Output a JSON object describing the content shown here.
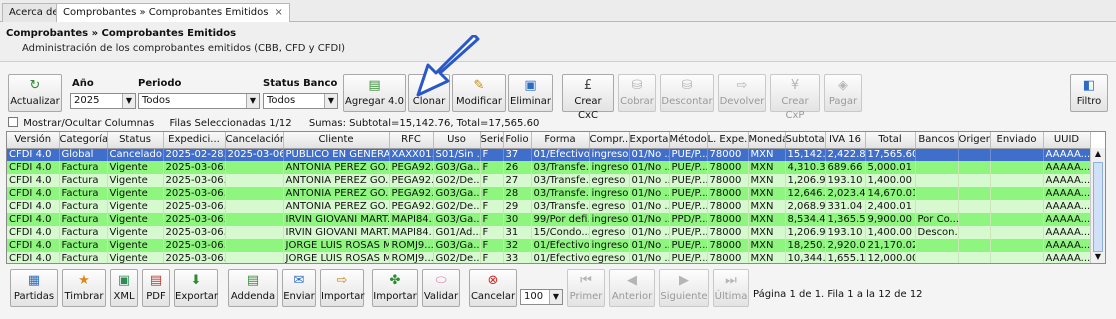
{
  "tabs": [
    {
      "label": "Acerca de"
    },
    {
      "label": "Comprobantes » Comprobantes Emitidos",
      "close": "×"
    }
  ],
  "header": {
    "title": "Comprobantes » Comprobantes Emitidos",
    "subtitle": "Administración de los comprobantes emitidos (CBB, CFD y CFDI)"
  },
  "filters": {
    "year_label": "Año",
    "year_value": "2025",
    "period_label": "Periodo",
    "period_value": "Todos",
    "bank_label": "Status Banco",
    "bank_value": "Todos"
  },
  "toolbar": {
    "refresh": "Actualizar",
    "add": "Agregar 4.0",
    "clone": "Clonar",
    "modify": "Modificar",
    "delete": "Eliminar",
    "create_cxc": "Crear CxC",
    "charge": "Cobrar",
    "discount": "Descontar",
    "return": "Devolver",
    "create_cxp": "Crear CxP",
    "pay": "Pagar",
    "filter": "Filtro"
  },
  "info": {
    "show_hide": "Mostrar/Ocultar Columnas",
    "selected": "Filas Seleccionadas 1/12",
    "sums": "Sumas:  Subtotal=15,142.76, Total=17,565.60"
  },
  "columns": [
    "Versión",
    "Categoría",
    "Status",
    "Expedici...",
    "Cancelación",
    "Cliente",
    "RFC",
    "Uso",
    "Serie",
    "Folio",
    "Forma",
    "Compr...",
    "Exporta...",
    "Método",
    "L. Expe...",
    "Moneda",
    "Subtotal",
    "IVA 16",
    "Total",
    "Bancos",
    "Origen",
    "Enviado",
    "UUID"
  ],
  "rows": [
    [
      "CFDI 4.0",
      "Global",
      "Cancelado",
      "2025-02-28...",
      "2025-03-06...",
      "PUBLICO EN GENERAL",
      "XAXX01...",
      "S01/Sin ...",
      "F",
      "37",
      "01/Efectivo",
      "ingreso",
      "01/No ...",
      "PUE/P...",
      "78000",
      "MXN",
      "15,142...",
      "2,422.84",
      "17,565.60",
      "",
      "",
      "",
      "AAAAA..."
    ],
    [
      "CFDI 4.0",
      "Factura",
      "Vigente",
      "2025-03-06...",
      "",
      "ANTONIA PEREZ GO...",
      "PEGA92...",
      "G03/Ga...",
      "F",
      "26",
      "03/Transfe...",
      "ingreso",
      "01/No ...",
      "PUE/P...",
      "78000",
      "MXN",
      "4,310.35",
      "689.66",
      "5,000.01",
      "",
      "",
      "",
      "AAAAA..."
    ],
    [
      "CFDI 4.0",
      "Factura",
      "Vigente",
      "2025-03-06...",
      "",
      "ANTONIA PEREZ GO...",
      "PEGA92...",
      "G02/De...",
      "F",
      "27",
      "03/Transfe...",
      "egreso",
      "01/No ...",
      "PUE/P...",
      "78000",
      "MXN",
      "1,206.90",
      "193.10",
      "1,400.00",
      "",
      "",
      "",
      "AAAAA..."
    ],
    [
      "CFDI 4.0",
      "Factura",
      "Vigente",
      "2025-03-06...",
      "",
      "ANTONIA PEREZ GO...",
      "PEGA92...",
      "G03/Ga...",
      "F",
      "28",
      "03/Transfe...",
      "ingreso",
      "01/No ...",
      "PUE/P...",
      "78000",
      "MXN",
      "12,646...",
      "2,023.45",
      "14,670.01",
      "",
      "",
      "",
      "AAAAA..."
    ],
    [
      "CFDI 4.0",
      "Factura",
      "Vigente",
      "2025-03-06...",
      "",
      "ANTONIA PEREZ GO...",
      "PEGA92...",
      "G02/De...",
      "F",
      "29",
      "03/Transfe...",
      "egreso",
      "01/No ...",
      "PUE/P...",
      "78000",
      "MXN",
      "2,068.97",
      "331.04",
      "2,400.01",
      "",
      "",
      "",
      "AAAAA..."
    ],
    [
      "CFDI 4.0",
      "Factura",
      "Vigente",
      "2025-03-06...",
      "",
      "IRVIN GIOVANI MART...",
      "MAPI84...",
      "G03/Ga...",
      "F",
      "30",
      "99/Por defi...",
      "ingreso",
      "01/No ...",
      "PPD/P...",
      "78000",
      "MXN",
      "8,534.49",
      "1,365.51",
      "9,900.00",
      "Por Co...",
      "",
      "",
      "AAAAA..."
    ],
    [
      "CFDI 4.0",
      "Factura",
      "Vigente",
      "2025-03-06...",
      "",
      "IRVIN GIOVANI MART...",
      "MAPI84...",
      "G01/Ad...",
      "F",
      "31",
      "15/Condo...",
      "egreso",
      "01/No ...",
      "PUE/P...",
      "78000",
      "MXN",
      "1,206.90",
      "193.10",
      "1,400.00",
      "Descon...",
      "",
      "",
      "AAAAA..."
    ],
    [
      "CFDI 4.0",
      "Factura",
      "Vigente",
      "2025-03-06...",
      "",
      "JORGE LUIS ROSAS M...",
      "ROMJ9...",
      "G03/Ga...",
      "F",
      "32",
      "01/Efectivo",
      "ingreso",
      "01/No ...",
      "PUE/P...",
      "78000",
      "MXN",
      "18,250...",
      "2,920.01",
      "21,170.02",
      "",
      "",
      "",
      "AAAAA..."
    ],
    [
      "CFDI 4.0",
      "Factura",
      "Vigente",
      "2025-03-06...",
      "",
      "JORGE LUIS ROSAS M...",
      "ROMJ9...",
      "G02/De...",
      "F",
      "33",
      "01/Efectivo",
      "egreso",
      "01/No ...",
      "PUE/P...",
      "78000",
      "MXN",
      "10,344...",
      "1,655.17",
      "12,000.00",
      "",
      "",
      "",
      "AAAAA..."
    ]
  ],
  "bottom": {
    "parts": "Partidas",
    "stamp": "Timbrar",
    "xml": "XML",
    "pdf": "PDF",
    "export": "Exportar",
    "addenda": "Addenda",
    "send": "Enviar",
    "import1": "Importar",
    "import2": "Importar",
    "validate": "Validar",
    "cancel": "Cancelar",
    "page_size": "100",
    "first": "Primer",
    "prev": "Anterior",
    "next": "Siguiente",
    "last": "Última",
    "page_info": "Página 1 de 1. Fila 1 a la 12 de 12"
  }
}
